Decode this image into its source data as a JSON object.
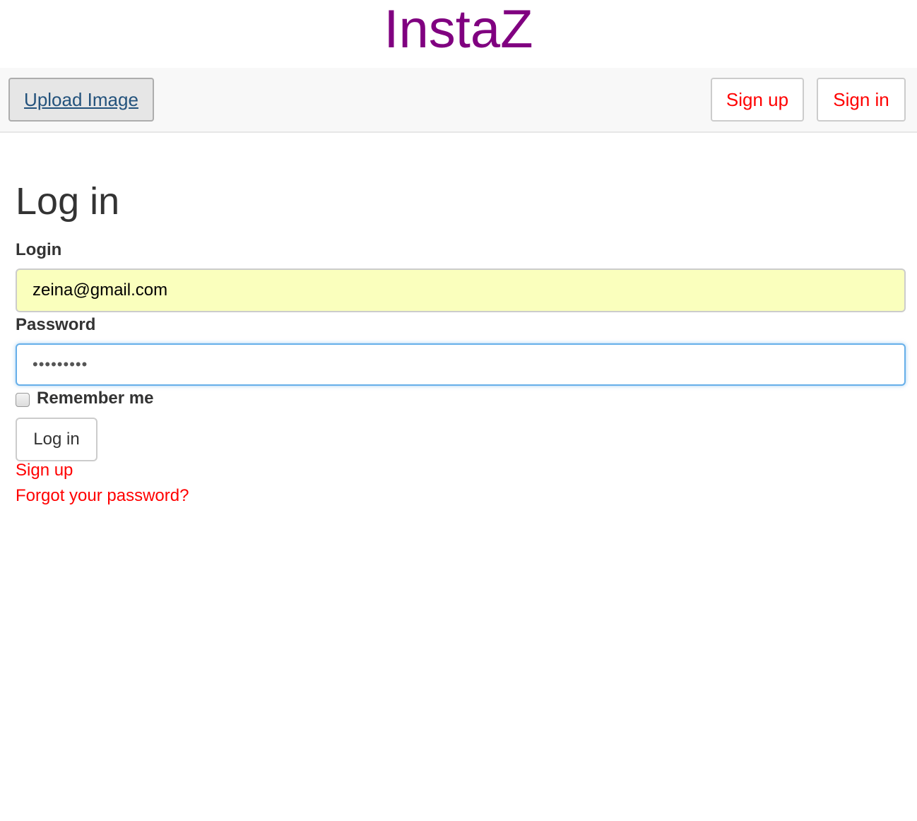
{
  "brand": {
    "title": "InstaZ",
    "color": "#800080"
  },
  "navbar": {
    "upload_label": "Upload Image",
    "signup_label": "Sign up",
    "signin_label": "Sign in"
  },
  "form": {
    "title": "Log in",
    "login_label": "Login",
    "login_value": "zeina@gmail.com",
    "password_label": "Password",
    "password_value": "•••••••••",
    "remember_label": "Remember me",
    "remember_checked": false,
    "submit_label": "Log in"
  },
  "links": {
    "signup": "Sign up",
    "forgot": "Forgot your password?"
  },
  "colors": {
    "link": "#ff0000",
    "autofill": "#faffbd",
    "focus": "#66afe9"
  }
}
